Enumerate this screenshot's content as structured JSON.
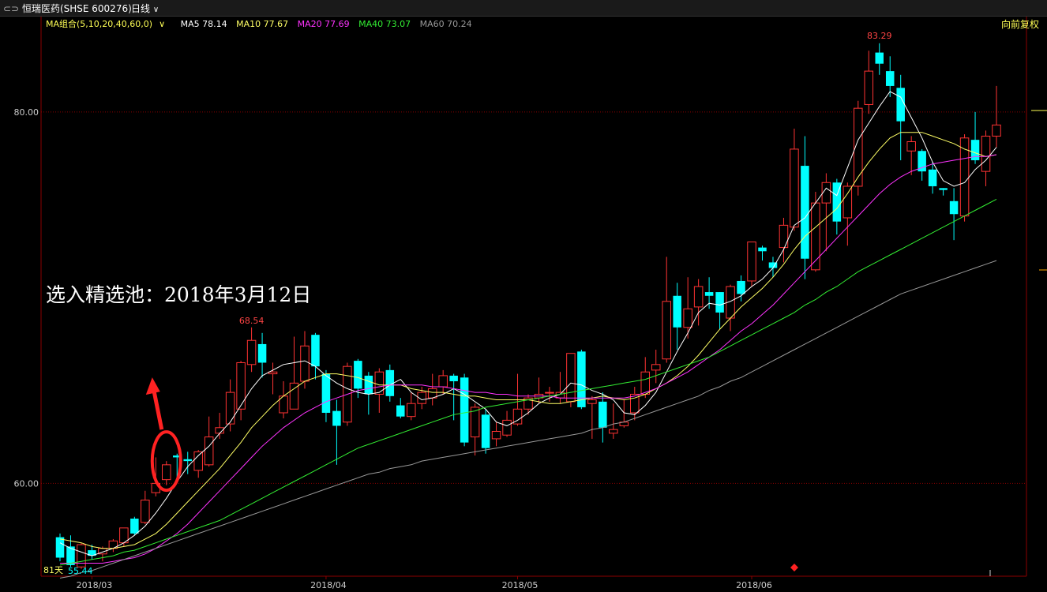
{
  "header": {
    "symbol_icon": "link-icon",
    "symbol": "恒瑞医药(SHSE 600276)",
    "period": "日线",
    "period_icon": "chevron-down-icon",
    "adjust": "向前复权"
  },
  "ma_legend": {
    "group": "MA组合(5,10,20,40,60,0)",
    "items": [
      {
        "label": "MA5 78.14",
        "color": "#ffffff"
      },
      {
        "label": "MA10 77.67",
        "color": "#ffff66"
      },
      {
        "label": "MA20 77.69",
        "color": "#ff33ff"
      },
      {
        "label": "MA40 73.07",
        "color": "#33ee33"
      },
      {
        "label": "MA60 70.24",
        "color": "#999999"
      }
    ]
  },
  "annotation": {
    "text": "选入精选池：2018年3月12日"
  },
  "bottom_labels": {
    "days": "81天",
    "low": "55.44"
  },
  "chart_data": {
    "type": "candlestick",
    "y_ticks": [
      {
        "value": 80,
        "label": "80.00"
      },
      {
        "value": 60,
        "label": "60.00"
      }
    ],
    "ylim": [
      55,
      84.5
    ],
    "high_label": "83.29",
    "mid_label": "68.54",
    "x_ticks": [
      {
        "index": 3,
        "label": "2018/03"
      },
      {
        "index": 25,
        "label": "2018/04"
      },
      {
        "index": 43,
        "label": "2018/05"
      },
      {
        "index": 65,
        "label": "2018/06"
      }
    ],
    "colors": {
      "up": "#ff3333",
      "down": "#00ffff",
      "grid": "#8b0000"
    },
    "ohlc": [
      [
        57.1,
        56.0,
        57.3,
        55.8
      ],
      [
        56.6,
        55.6,
        57.2,
        55.5
      ],
      [
        55.5,
        56.7,
        56.8,
        55.4
      ],
      [
        56.4,
        56.1,
        56.7,
        55.9
      ],
      [
        56.2,
        56.5,
        56.6,
        55.8
      ],
      [
        56.5,
        56.9,
        57.0,
        56.3
      ],
      [
        56.8,
        57.6,
        57.6,
        56.6
      ],
      [
        58.1,
        57.3,
        58.2,
        57.2
      ],
      [
        57.9,
        59.1,
        59.6,
        57.8
      ],
      [
        59.5,
        60.0,
        61.4,
        59.3
      ],
      [
        60.2,
        61.0,
        61.2,
        59.9
      ],
      [
        61.5,
        61.4,
        61.6,
        60.1
      ],
      [
        61.3,
        61.2,
        61.7,
        60.5
      ],
      [
        60.7,
        61.7,
        61.8,
        60.3
      ],
      [
        61.0,
        62.5,
        63.6,
        60.9
      ],
      [
        62.7,
        63.0,
        63.8,
        62.4
      ],
      [
        63.2,
        64.9,
        65.6,
        62.8
      ],
      [
        64.0,
        66.5,
        66.6,
        63.4
      ],
      [
        66.4,
        67.7,
        68.4,
        66.0
      ],
      [
        67.5,
        66.5,
        68.1,
        65.7
      ],
      [
        65.9,
        66.0,
        66.5,
        64.8
      ],
      [
        63.8,
        64.7,
        65.5,
        63.5
      ],
      [
        64.0,
        65.4,
        67.9,
        64.1
      ],
      [
        65.5,
        67.4,
        68.2,
        65.1
      ],
      [
        68.0,
        66.3,
        68.1,
        65.6
      ],
      [
        65.9,
        63.8,
        66.1,
        63.3
      ],
      [
        63.9,
        63.1,
        64.5,
        61.0
      ],
      [
        63.3,
        66.3,
        66.5,
        63.1
      ],
      [
        66.6,
        65.1,
        66.7,
        64.6
      ],
      [
        65.8,
        64.8,
        66.0,
        63.7
      ],
      [
        64.8,
        66.0,
        66.2,
        63.8
      ],
      [
        66.1,
        64.7,
        66.4,
        64.4
      ],
      [
        64.2,
        63.6,
        64.6,
        63.5
      ],
      [
        63.6,
        64.3,
        64.9,
        63.4
      ],
      [
        64.3,
        64.9,
        65.2,
        64.0
      ],
      [
        64.6,
        65.1,
        65.9,
        64.2
      ],
      [
        65.2,
        65.8,
        66.1,
        64.8
      ],
      [
        65.8,
        65.5,
        65.9,
        63.4
      ],
      [
        65.7,
        62.2,
        65.9,
        62.0
      ],
      [
        62.5,
        64.1,
        64.3,
        61.5
      ],
      [
        63.7,
        61.9,
        64.0,
        61.6
      ],
      [
        62.4,
        62.8,
        63.3,
        62.0
      ],
      [
        62.6,
        63.4,
        63.9,
        62.5
      ],
      [
        63.2,
        64.0,
        65.9,
        63.1
      ],
      [
        64.0,
        64.6,
        64.8,
        63.7
      ],
      [
        64.6,
        64.8,
        65.7,
        64.3
      ],
      [
        64.9,
        64.9,
        65.2,
        64.4
      ],
      [
        64.6,
        64.9,
        66.0,
        64.3
      ],
      [
        64.4,
        67.0,
        67.0,
        64.1
      ],
      [
        67.1,
        64.1,
        67.2,
        64.0
      ],
      [
        64.3,
        64.5,
        64.7,
        62.4
      ],
      [
        64.4,
        63.0,
        64.9,
        62.2
      ],
      [
        62.7,
        62.9,
        64.3,
        62.4
      ],
      [
        63.1,
        63.3,
        64.5,
        63.0
      ],
      [
        63.8,
        64.8,
        65.2,
        63.4
      ],
      [
        64.8,
        66.0,
        66.8,
        64.6
      ],
      [
        66.1,
        66.4,
        67.2,
        65.4
      ],
      [
        66.7,
        69.8,
        72.2,
        66.5
      ],
      [
        70.1,
        68.4,
        70.8,
        67.2
      ],
      [
        68.4,
        69.4,
        71.1,
        67.8
      ],
      [
        69.5,
        70.6,
        71.0,
        68.5
      ],
      [
        70.3,
        70.1,
        71.1,
        69.4
      ],
      [
        70.3,
        69.2,
        70.3,
        68.3
      ],
      [
        68.9,
        70.6,
        70.7,
        68.2
      ],
      [
        70.9,
        70.2,
        71.2,
        69.8
      ],
      [
        70.9,
        73.0,
        73.0,
        70.6
      ],
      [
        72.7,
        72.5,
        72.8,
        72.0
      ],
      [
        71.9,
        71.6,
        72.2,
        71.1
      ],
      [
        72.7,
        73.9,
        74.3,
        71.9
      ],
      [
        73.8,
        78.0,
        79.1,
        73.6
      ],
      [
        77.1,
        72.1,
        78.7,
        71.0
      ],
      [
        71.5,
        75.1,
        75.7,
        71.4
      ],
      [
        75.1,
        76.2,
        76.7,
        72.5
      ],
      [
        76.2,
        74.1,
        76.4,
        73.4
      ],
      [
        74.3,
        76.0,
        76.2,
        72.8
      ],
      [
        76.0,
        80.2,
        80.6,
        75.5
      ],
      [
        80.4,
        82.2,
        83.3,
        79.9
      ],
      [
        83.2,
        82.6,
        83.7,
        82.0
      ],
      [
        82.2,
        81.4,
        83.0,
        80.8
      ],
      [
        81.3,
        79.5,
        82.0,
        77.4
      ],
      [
        77.9,
        78.4,
        78.7,
        76.6
      ],
      [
        77.9,
        76.8,
        78.0,
        76.3
      ],
      [
        76.9,
        76.0,
        77.3,
        75.6
      ],
      [
        75.9,
        75.8,
        75.9,
        75.5
      ],
      [
        75.2,
        74.5,
        75.9,
        73.1
      ],
      [
        74.4,
        78.6,
        78.8,
        74.1
      ],
      [
        78.5,
        77.4,
        80.0,
        77.2
      ],
      [
        76.8,
        78.7,
        79.0,
        76.0
      ],
      [
        78.7,
        79.3,
        81.4,
        78.1
      ]
    ],
    "ma": {
      "ma5": [
        56.8,
        56.5,
        56.3,
        56.1,
        56.3,
        56.5,
        56.8,
        57.2,
        57.7,
        58.4,
        59.2,
        60.1,
        60.9,
        61.5,
        62.0,
        62.7,
        63.3,
        64.2,
        65.1,
        65.8,
        66.1,
        66.4,
        66.5,
        66.6,
        66.3,
        65.8,
        65.4,
        65.1,
        64.9,
        64.8,
        64.9,
        65.3,
        65.6,
        64.9,
        64.5,
        64.6,
        64.8,
        65.1,
        64.8,
        64.4,
        64.0,
        63.3,
        63.1,
        63.4,
        63.8,
        64.3,
        64.6,
        64.8,
        65.4,
        65.3,
        65.0,
        64.8,
        64.5,
        63.8,
        63.7,
        64.2,
        64.9,
        66.0,
        67.1,
        68.1,
        69.2,
        69.7,
        69.6,
        69.8,
        70.1,
        70.6,
        71.0,
        71.6,
        72.6,
        73.9,
        74.3,
        75.1,
        75.9,
        75.5,
        77.0,
        78.5,
        79.4,
        80.3,
        81.1,
        80.8,
        79.7,
        78.6,
        77.3,
        76.3,
        76.0,
        76.2,
        76.9,
        77.4,
        78.1
      ],
      "ma10": [
        57.0,
        56.9,
        56.8,
        56.6,
        56.5,
        56.5,
        56.6,
        56.7,
        57.0,
        57.3,
        57.8,
        58.4,
        59.0,
        59.6,
        60.2,
        60.8,
        61.5,
        62.2,
        63.0,
        63.6,
        64.2,
        64.7,
        65.1,
        65.5,
        65.7,
        65.9,
        65.9,
        65.8,
        65.7,
        65.5,
        65.3,
        65.3,
        65.3,
        65.1,
        65.0,
        64.9,
        64.9,
        64.8,
        64.7,
        64.7,
        64.6,
        64.5,
        64.5,
        64.5,
        64.5,
        64.4,
        64.3,
        64.3,
        64.4,
        64.5,
        64.6,
        64.7,
        64.6,
        64.5,
        64.6,
        64.8,
        65.1,
        65.4,
        65.8,
        66.3,
        66.9,
        67.6,
        68.3,
        68.9,
        69.5,
        70.0,
        70.5,
        71.1,
        71.8,
        72.6,
        73.3,
        73.8,
        74.3,
        74.8,
        75.6,
        76.5,
        77.3,
        78.0,
        78.6,
        78.9,
        78.9,
        78.9,
        78.7,
        78.5,
        78.3,
        78.0,
        77.8,
        77.6,
        77.7
      ],
      "ma20": [
        55.7,
        55.7,
        55.7,
        55.7,
        55.7,
        55.8,
        55.9,
        56.0,
        56.2,
        56.5,
        56.9,
        57.3,
        57.8,
        58.4,
        59.0,
        59.6,
        60.2,
        60.8,
        61.4,
        62.0,
        62.5,
        63.0,
        63.4,
        63.8,
        64.1,
        64.4,
        64.6,
        64.8,
        65.0,
        65.1,
        65.2,
        65.3,
        65.3,
        65.3,
        65.3,
        65.2,
        65.2,
        65.1,
        65.0,
        64.9,
        64.9,
        64.8,
        64.8,
        64.7,
        64.7,
        64.7,
        64.7,
        64.6,
        64.6,
        64.6,
        64.6,
        64.6,
        64.6,
        64.6,
        64.7,
        64.9,
        65.1,
        65.4,
        65.7,
        66.0,
        66.4,
        66.8,
        67.2,
        67.7,
        68.2,
        68.6,
        69.1,
        69.6,
        70.2,
        70.8,
        71.4,
        72.0,
        72.6,
        73.2,
        73.8,
        74.4,
        75.0,
        75.6,
        76.1,
        76.5,
        76.8,
        77.0,
        77.2,
        77.3,
        77.4,
        77.5,
        77.6,
        77.6,
        77.7
      ],
      "ma40": [
        55.6,
        55.7,
        55.8,
        55.9,
        56.0,
        56.1,
        56.3,
        56.4,
        56.6,
        56.8,
        57.0,
        57.2,
        57.4,
        57.6,
        57.8,
        58.0,
        58.3,
        58.6,
        58.9,
        59.2,
        59.5,
        59.8,
        60.1,
        60.4,
        60.7,
        61.0,
        61.3,
        61.6,
        61.9,
        62.1,
        62.3,
        62.5,
        62.7,
        62.9,
        63.1,
        63.3,
        63.5,
        63.7,
        63.8,
        63.9,
        64.1,
        64.2,
        64.3,
        64.4,
        64.5,
        64.6,
        64.7,
        64.8,
        64.9,
        65.0,
        65.1,
        65.2,
        65.3,
        65.4,
        65.5,
        65.6,
        65.8,
        66.0,
        66.2,
        66.4,
        66.6,
        66.8,
        67.1,
        67.4,
        67.7,
        68.0,
        68.3,
        68.6,
        68.9,
        69.2,
        69.6,
        69.9,
        70.3,
        70.6,
        71.0,
        71.4,
        71.7,
        72.0,
        72.3,
        72.6,
        72.9,
        73.2,
        73.5,
        73.8,
        74.1,
        74.4,
        74.7,
        75.0,
        75.3
      ],
      "ma60": [
        54.9,
        55.0,
        55.2,
        55.3,
        55.5,
        55.7,
        55.9,
        56.1,
        56.3,
        56.5,
        56.7,
        56.9,
        57.1,
        57.3,
        57.5,
        57.7,
        57.9,
        58.1,
        58.3,
        58.5,
        58.7,
        58.9,
        59.1,
        59.3,
        59.5,
        59.7,
        59.9,
        60.1,
        60.3,
        60.5,
        60.6,
        60.8,
        60.9,
        61.0,
        61.2,
        61.3,
        61.4,
        61.5,
        61.6,
        61.7,
        61.8,
        61.9,
        62.0,
        62.1,
        62.2,
        62.3,
        62.4,
        62.5,
        62.6,
        62.7,
        62.9,
        63.0,
        63.2,
        63.3,
        63.5,
        63.7,
        63.9,
        64.1,
        64.3,
        64.5,
        64.7,
        65.0,
        65.2,
        65.5,
        65.7,
        66.0,
        66.3,
        66.6,
        66.9,
        67.2,
        67.5,
        67.8,
        68.1,
        68.4,
        68.7,
        69.0,
        69.3,
        69.6,
        69.9,
        70.2,
        70.4,
        70.6,
        70.8,
        71.0,
        71.2,
        71.4,
        71.6,
        71.8,
        72.0
      ]
    }
  }
}
